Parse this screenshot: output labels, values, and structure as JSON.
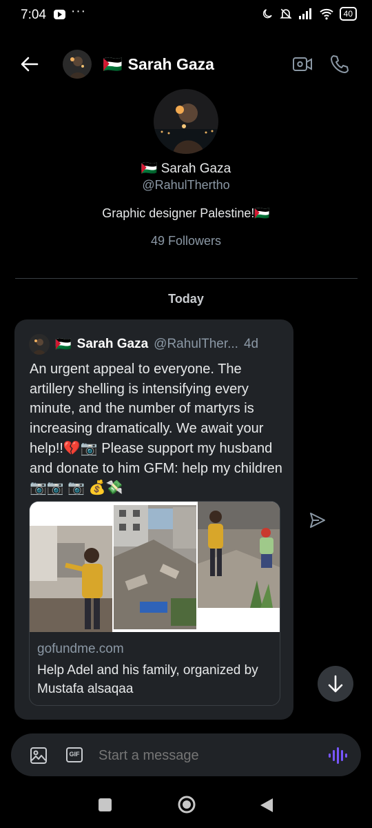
{
  "status_bar": {
    "time": "7:04",
    "battery": "40"
  },
  "header": {
    "flag": "🇵🇸",
    "name": "Sarah Gaza"
  },
  "profile": {
    "name": "🇵🇸 Sarah Gaza",
    "handle": "@RahulThertho",
    "bio": "Graphic designer Palestine!🇵🇸",
    "followers": "49 Followers"
  },
  "date_separator": "Today",
  "message": {
    "flag": "🇵🇸",
    "author_name": "Sarah Gaza",
    "author_handle": "@RahulTher...",
    "age": "4d",
    "text": "An urgent appeal to everyone. The artillery shelling is intensifying every minute, and the number of martyrs is increasing dramatically. We await your help!!💔📷 Please support my husband and donate to him GFM: help my children 📷📷 📷 💰💸",
    "link": {
      "domain": "gofundme.com",
      "title": "Help Adel and his family, organized by Mustafa alsaqaa"
    }
  },
  "composer": {
    "placeholder": "Start a message",
    "gif_label": "GIF"
  },
  "colors": {
    "background": "#000000",
    "bubble": "#202327",
    "accent_voice": "#7856ff"
  }
}
